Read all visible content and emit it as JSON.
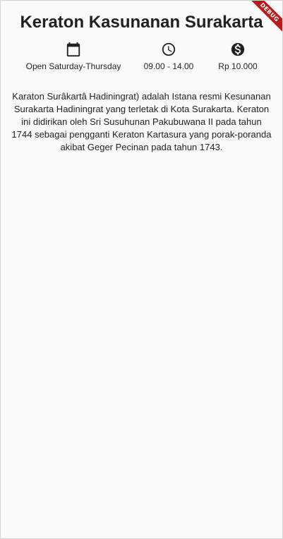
{
  "page": {
    "title": "Keraton Kasunanan Surakarta",
    "description": "Karaton Surâkartâ Hadiningrat) adalah Istana resmi Kesunanan Surakarta Hadiningrat yang terletak di Kota Surakarta. Keraton ini didirikan oleh Sri Susuhunan Pakubuwana II pada tahun 1744 sebagai pengganti Keraton Kartasura yang porak-poranda akibat Geger Pecinan pada tahun 1743."
  },
  "info": [
    {
      "icon": "calendar-icon",
      "label": "Open Saturday-Thursday"
    },
    {
      "icon": "clock-icon",
      "label": "09.00 - 14.00"
    },
    {
      "icon": "dollar-icon",
      "label": "Rp 10.000"
    }
  ],
  "debug_banner": {
    "label": "DEBUG",
    "color": "#b71c1c"
  },
  "colors": {
    "background": "#fafafa",
    "text": "#212121"
  }
}
